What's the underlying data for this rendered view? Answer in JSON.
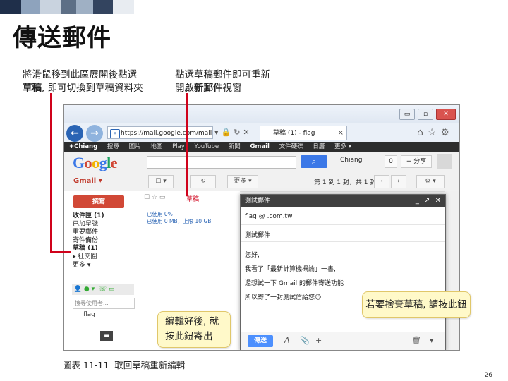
{
  "slide": {
    "title": "傳送郵件",
    "page_number": "26",
    "caption": "圖表 11-11  取回草稿重新編輯",
    "top_callouts": {
      "left_line1": "將滑鼠移到此區展開後點選",
      "left_bold": "草稿",
      "left_line2_rest": ", 即可切換到草稿資料夾",
      "right_line1": "點選草稿郵件即可重新",
      "right_line2_a": "開啟",
      "right_bold": "新郵件",
      "right_line2_b": "視窗"
    },
    "bubble_discard": "若要捨棄草稿, 請按此鈕",
    "bubble_send_line1": "編輯好後, 就",
    "bubble_send_line2": "按此鈕寄出"
  },
  "browser": {
    "address": "https://mail.google.com/mail/",
    "tab_title": "草稿 (1) - flag",
    "tab_close": "×",
    "window_controls": [
      "▭",
      "▫",
      "✕"
    ]
  },
  "gmail_bar": {
    "user": "+Chiang",
    "items": [
      "搜尋",
      "圖片",
      "地圖",
      "Play",
      "YouTube",
      "新聞"
    ],
    "bold_item": "Gmail",
    "more_items": [
      "文件硬碟",
      "日曆",
      "更多 ▾"
    ]
  },
  "header": {
    "logo_letters": [
      "G",
      "o",
      "o",
      "g",
      "l",
      "e"
    ],
    "logo_colors": [
      "#3b78e7",
      "#d14836",
      "#f2b400",
      "#3b78e7",
      "#1aa260",
      "#d14836"
    ],
    "account": "Chiang",
    "count": "0",
    "share": "+ 分享"
  },
  "toolbar": {
    "gmail_label": "Gmail ▾",
    "refresh": "↻",
    "more": "更多 ▾",
    "pager": "第 1 到 1 封，共 1 封",
    "gear": "⚙ ▾"
  },
  "nav": {
    "compose": "撰寫",
    "items": [
      {
        "label": "收件匣 (1)",
        "bold": true
      },
      {
        "label": "已加星號",
        "bold": false
      },
      {
        "label": "重要郵件",
        "bold": false
      },
      {
        "label": "寄件備份",
        "bold": false
      },
      {
        "label": "草稿 (1)",
        "bold": true
      },
      {
        "label": "▸ 社交圈",
        "bold": false
      },
      {
        "label": "更多 ▾",
        "bold": false
      }
    ],
    "chat_search_placeholder": "搜尋使用者...",
    "chat_contact": "flag"
  },
  "message_list": {
    "draft_tag": "草稿",
    "preview_line1": "已使用 0%",
    "preview_line2": "已使用 0 MB，上限 10 GB"
  },
  "compose_window": {
    "title": "測試郵件",
    "controls": "_ ↗ ✕",
    "to": "flag          @        .com.tw",
    "subject": "測試郵件",
    "body_lines": [
      "您好,",
      "我看了「最新計算機概論」一書,",
      "還想試一下 Gmail 的郵件寄送功能",
      "所以寄了一封測試信給您😊"
    ],
    "send": "傳送",
    "format_icon": "A",
    "attach_icon": "📎",
    "plus_icon": "+",
    "trash_icon": "🗑",
    "more_icon": "▾"
  },
  "colors": {
    "pointer": "#d0021b",
    "deco": [
      "#1f2f4a",
      "#8ea3bd",
      "#c9d3df",
      "#5d6f86",
      "#e8ecf1"
    ]
  }
}
